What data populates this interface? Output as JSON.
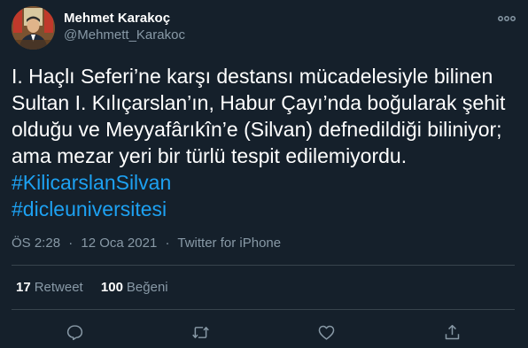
{
  "user": {
    "name": "Mehmet Karakoç",
    "handle": "@Mehmett_Karakoc"
  },
  "tweet": {
    "lines": [
      "I. Haçlı Seferi’ne karşı destansı mücadelesiyle bilinen",
      "Sultan I. Kılıçarslan’ın, Habur Çayı’nda boğularak şehit",
      "olduğu ve Meyyafârıkîn’e (Silvan) defnedildiği biliniyor;",
      "ama mezar yeri bir türlü tespit edilemiyordu."
    ],
    "hashtags": [
      "#KilicarslanSilvan",
      "#dicleuniversitesi"
    ],
    "time": "ÖS 2:28",
    "date": "12 Oca 2021",
    "separator": "·",
    "source": "Twitter for iPhone"
  },
  "stats": {
    "retweets_count": "17",
    "retweets_label": "Retweet",
    "likes_count": "100",
    "likes_label": "Beğeni"
  },
  "icons": {
    "more": "more-icon",
    "reply": "reply-icon",
    "retweet": "retweet-icon",
    "like": "like-icon",
    "share": "share-icon"
  },
  "colors": {
    "background": "#15202b",
    "text": "#ffffff",
    "secondary": "#8899a6",
    "link": "#1da1f2",
    "divider": "#38444d"
  }
}
